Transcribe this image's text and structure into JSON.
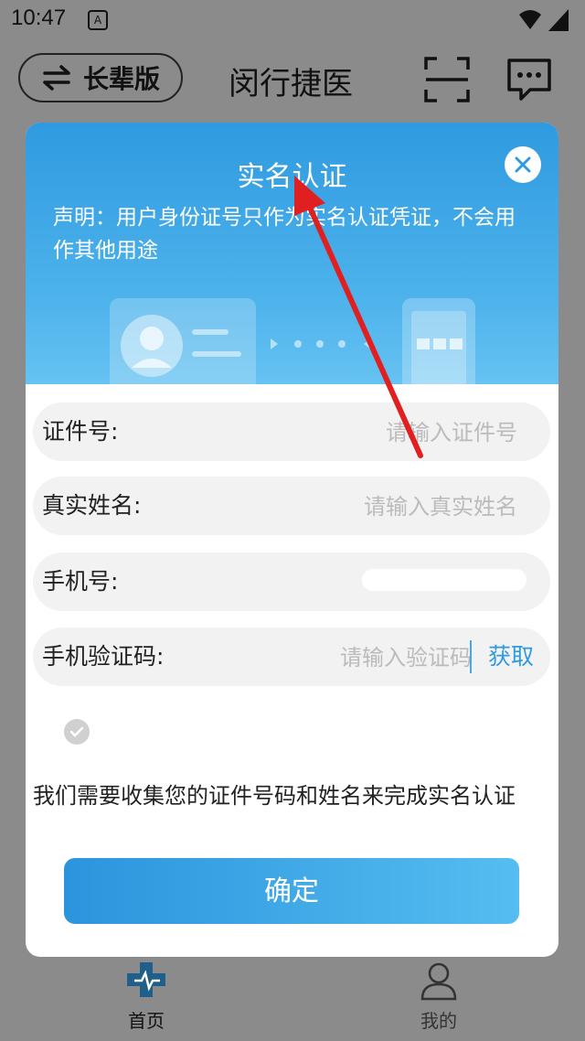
{
  "status_bar": {
    "time": "10:47",
    "notif_badge": "A"
  },
  "header": {
    "mode_label": "长辈版",
    "title": "闵行捷医"
  },
  "modal": {
    "title": "实名认证",
    "notice": "声明：用户身份证号只作为实名认证凭证，不会用作其他用途",
    "fields": [
      {
        "label": "证件号:",
        "placeholder": "请输入证件号"
      },
      {
        "label": "真实姓名:",
        "placeholder": "请输入真实姓名"
      },
      {
        "label": "手机号:"
      },
      {
        "label": "手机验证码:",
        "placeholder": "请输入验证码",
        "action": "获取"
      }
    ],
    "consent": "我们需要收集您的证件号码和姓名来完成实名认证",
    "confirm_label": "确定"
  },
  "bottom_nav": [
    {
      "label": "首页",
      "icon": "medical-cross-icon"
    },
    {
      "label": "我的",
      "icon": "user-icon"
    }
  ],
  "colors": {
    "accent": "#2e9ae0",
    "annotation": "#e02020"
  }
}
